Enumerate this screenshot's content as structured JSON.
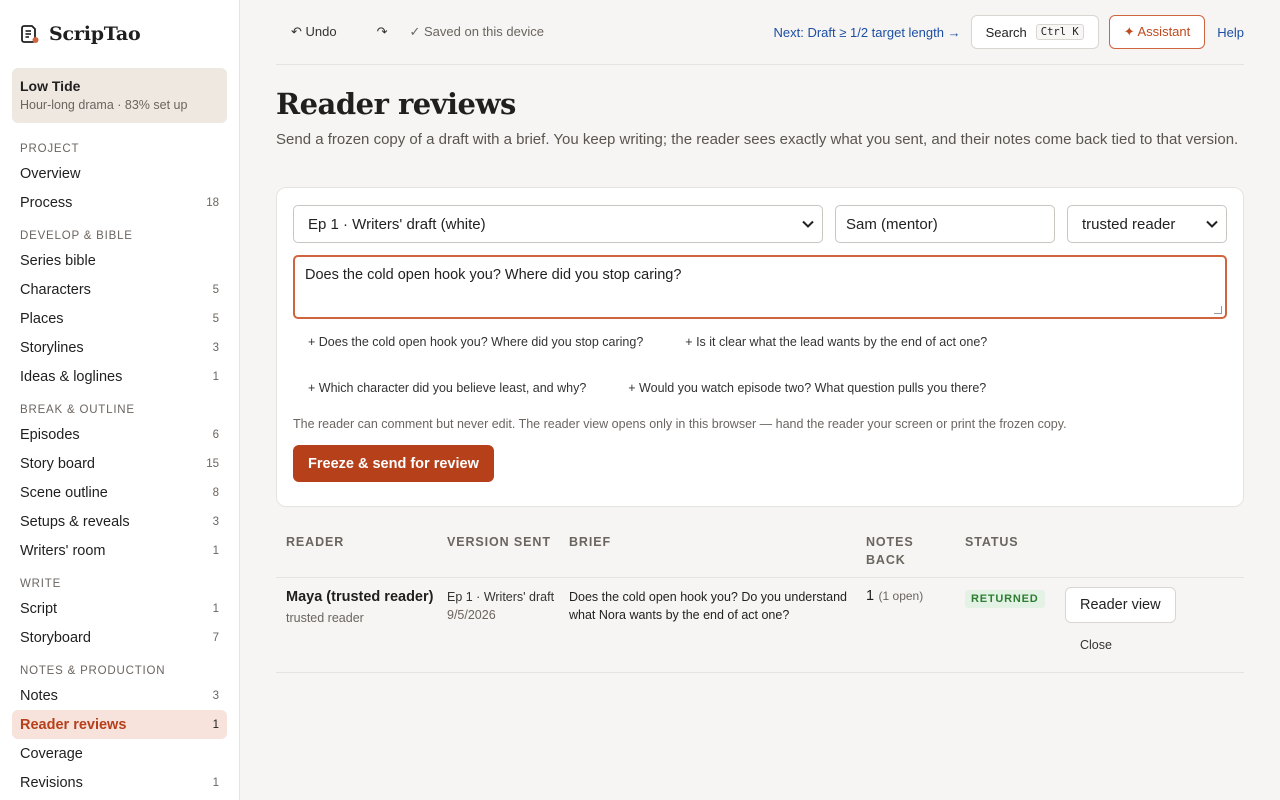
{
  "app": {
    "name": "ScripTao"
  },
  "project": {
    "name": "Low Tide",
    "subtitle": "Hour-long drama · 83% set up"
  },
  "sidebar": {
    "sections": [
      {
        "title": "PROJECT",
        "items": [
          {
            "label": "Overview",
            "count": ""
          },
          {
            "label": "Process",
            "count": "18"
          }
        ]
      },
      {
        "title": "DEVELOP & BIBLE",
        "items": [
          {
            "label": "Series bible",
            "count": ""
          },
          {
            "label": "Characters",
            "count": "5"
          },
          {
            "label": "Places",
            "count": "5"
          },
          {
            "label": "Storylines",
            "count": "3"
          },
          {
            "label": "Ideas & loglines",
            "count": "1"
          }
        ]
      },
      {
        "title": "BREAK & OUTLINE",
        "items": [
          {
            "label": "Episodes",
            "count": "6"
          },
          {
            "label": "Story board",
            "count": "15"
          },
          {
            "label": "Scene outline",
            "count": "8"
          },
          {
            "label": "Setups & reveals",
            "count": "3"
          },
          {
            "label": "Writers' room",
            "count": "1"
          }
        ]
      },
      {
        "title": "WRITE",
        "items": [
          {
            "label": "Script",
            "count": "1"
          },
          {
            "label": "Storyboard",
            "count": "7"
          }
        ]
      },
      {
        "title": "NOTES & PRODUCTION",
        "items": [
          {
            "label": "Notes",
            "count": "3"
          },
          {
            "label": "Reader reviews",
            "count": "1",
            "active": true
          },
          {
            "label": "Coverage",
            "count": ""
          },
          {
            "label": "Revisions",
            "count": "1"
          }
        ]
      }
    ]
  },
  "toolbar": {
    "undo_label": "↶ Undo",
    "redo_label": "↷",
    "saved_label": "✓ Saved on this device",
    "next_label": "Next: Draft ≥ 1/2 target length →",
    "search_label": "Search",
    "search_shortcut": "Ctrl K",
    "assistant_label": "✦ Assistant",
    "help_label": "Help"
  },
  "page": {
    "title": "Reader reviews",
    "description": "Send a frozen copy of a draft with a brief. You keep writing; the reader sees exactly what you sent, and their notes come back tied to that version."
  },
  "form": {
    "draft_select": "Ep 1 · Writers' draft (white)",
    "reader_name": "Sam (mentor)",
    "reader_type_select": "trusted reader",
    "brief_value": "Does the cold open hook you? Where did you stop caring?",
    "suggestions": [
      "+ Does the cold open hook you? Where did you stop caring?",
      "+ Is it clear what the lead wants by the end of act one?",
      "+ Which character did you believe least, and why?",
      "+ Would you watch episode two? What question pulls you there?"
    ],
    "note": "The reader can comment but never edit. The reader view opens only in this browser — hand the reader your screen or print the frozen copy.",
    "submit_label": "Freeze & send for review"
  },
  "table": {
    "headers": [
      "READER",
      "VERSION SENT",
      "BRIEF",
      "NOTES BACK",
      "STATUS",
      ""
    ],
    "rows": [
      {
        "reader_name": "Maya (trusted reader)",
        "reader_type": "trusted reader",
        "version": "Ep 1 · Writers' draft",
        "date": "9/5/2026",
        "brief": "Does the cold open hook you? Do you understand what Nora wants by the end of act one?",
        "notes_count": "1",
        "notes_open": "(1 open)",
        "status": "RETURNED",
        "reader_view_label": "Reader view",
        "close_label": "Close"
      }
    ]
  },
  "colors": {
    "accent": "#b5401a",
    "link": "#1d4fa3",
    "success": "#2e7d32"
  }
}
